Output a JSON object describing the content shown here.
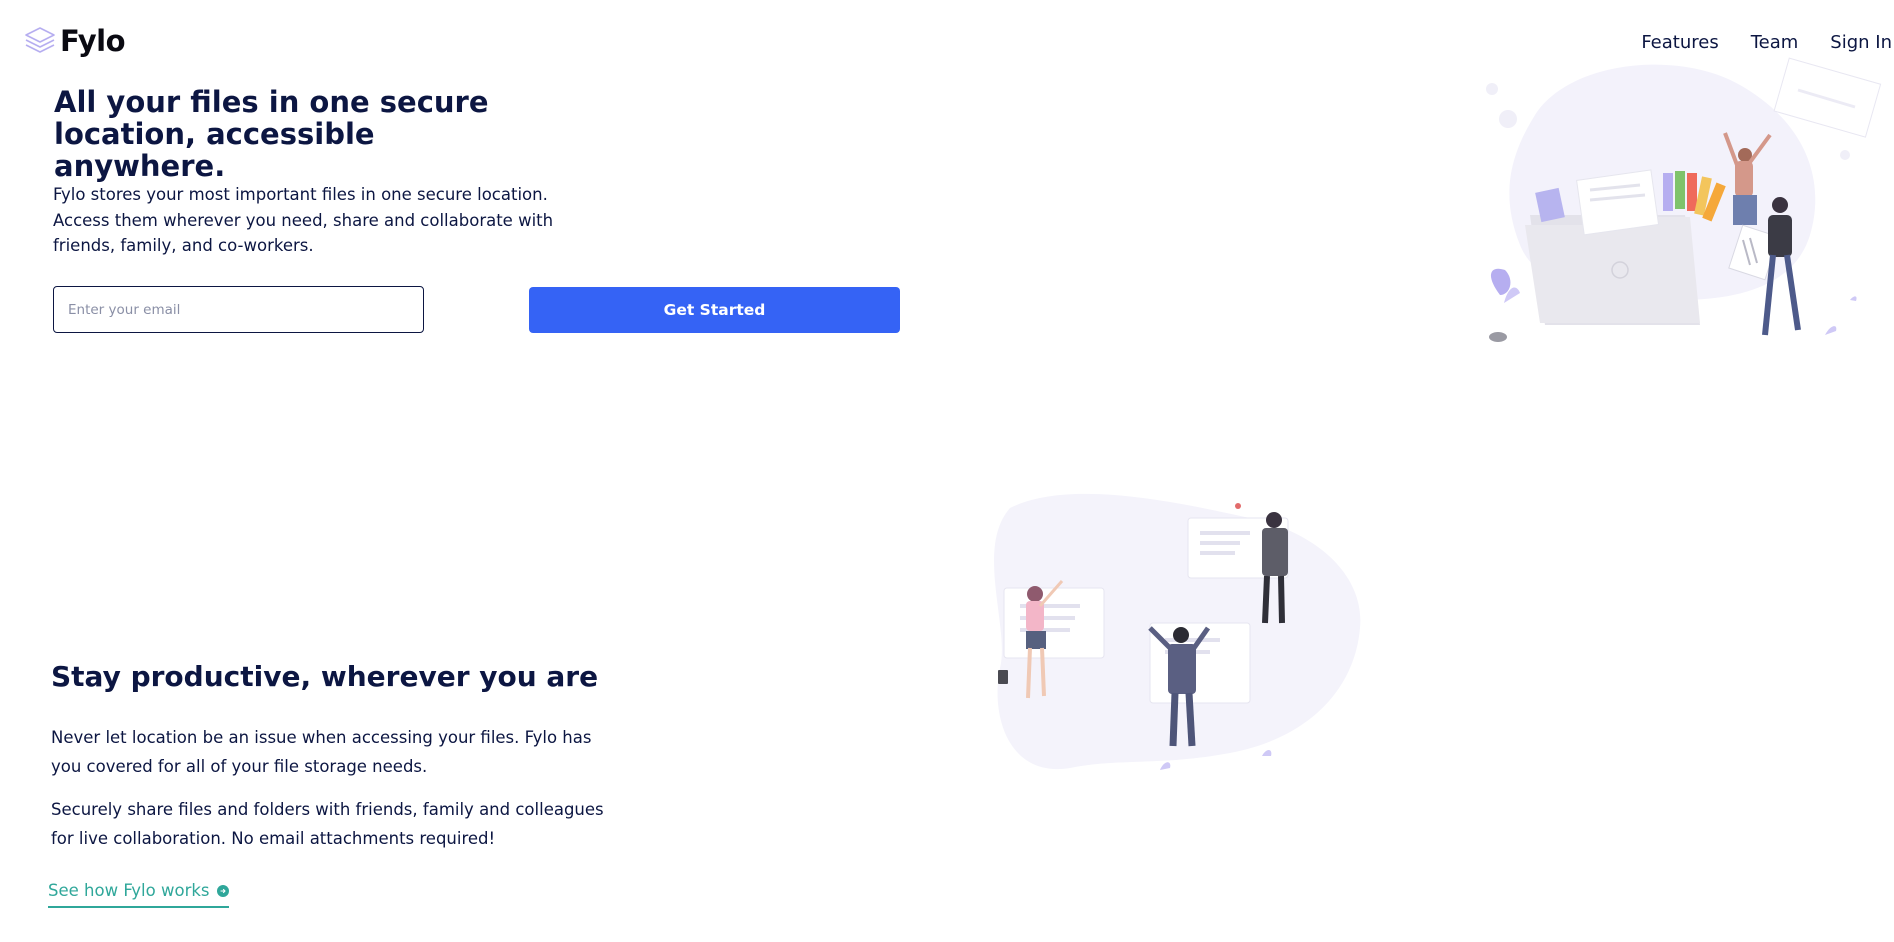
{
  "header": {
    "logo_text": "Fylo",
    "logo_icon": "stacked-layers-icon",
    "nav": [
      {
        "label": "Features"
      },
      {
        "label": "Team"
      },
      {
        "label": "Sign In"
      }
    ]
  },
  "hero": {
    "title": "All your files in one secure location, accessible anywhere.",
    "description": "Fylo stores your most important files in one secure location. Access them wherever you need, share and collaborate with friends, family, and co-workers.",
    "email_placeholder": "Enter your email",
    "email_value": "",
    "cta_label": "Get Started"
  },
  "productive": {
    "title": "Stay productive, wherever you are",
    "paragraph_1": "Never let location be an issue when accessing your files. Fylo has you covered for all of your file storage needs.",
    "paragraph_2": "Securely share files and folders with friends, family and colleagues for live collaboration. No email attachments required!",
    "link_label": "See how Fylo works",
    "link_icon": "arrow-circle-icon"
  },
  "colors": {
    "primary_blue": "#3563f5",
    "dark_navy": "#0c1642",
    "teal": "#2fa79a",
    "logo_purple": "#b6aef0"
  }
}
